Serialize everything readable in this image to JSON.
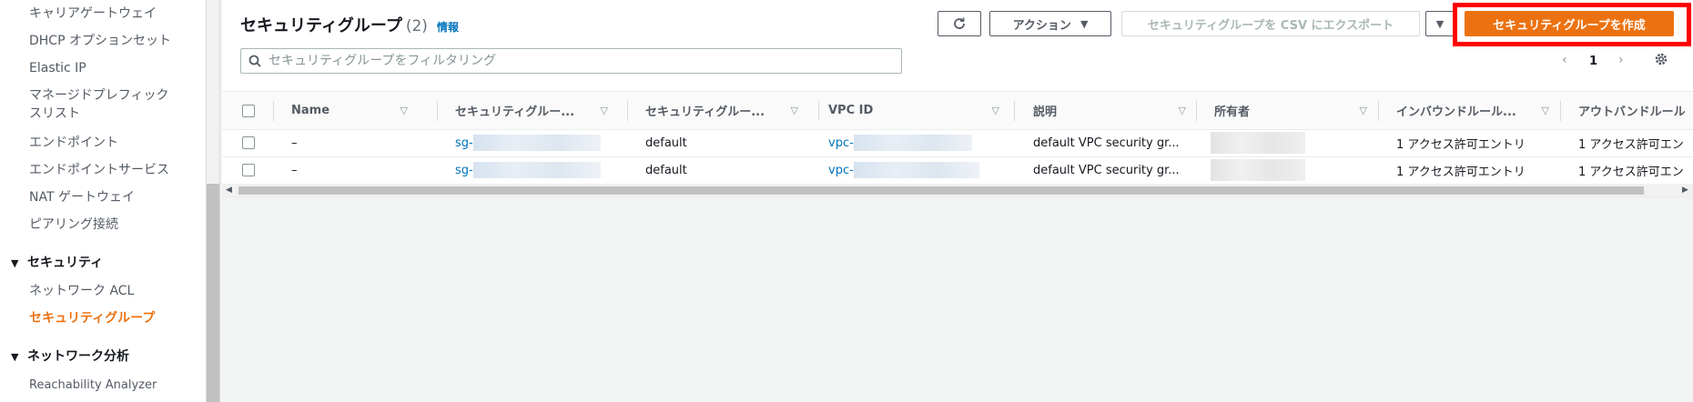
{
  "sidebar": {
    "items": [
      {
        "label": "キャリアゲートウェイ"
      },
      {
        "label": "DHCP オプションセット"
      },
      {
        "label": "Elastic IP"
      },
      {
        "label_line1": "マネージドプレフィック",
        "label_line2": "スリスト"
      },
      {
        "label": "エンドポイント"
      },
      {
        "label": "エンドポイントサービス"
      },
      {
        "label": "NAT ゲートウェイ"
      },
      {
        "label": "ピアリング接続"
      }
    ],
    "security_section": "セキュリティ",
    "security_items": [
      "ネットワーク ACL",
      "セキュリティグループ"
    ],
    "analysis_section": "ネットワーク分析",
    "analysis_items": [
      "Reachability Analyzer"
    ]
  },
  "header": {
    "title": "セキュリティグループ",
    "count": "(2)",
    "info": "情報",
    "actions_label": "アクション",
    "export_label": "セキュリティグループを CSV にエクスポート",
    "create_label": "セキュリティグループを作成"
  },
  "search": {
    "placeholder": "セキュリティグループをフィルタリング"
  },
  "pagination": {
    "page": "1"
  },
  "table": {
    "columns": [
      "Name",
      "セキュリティグルー...",
      "セキュリティグルー...",
      "VPC ID",
      "説明",
      "所有者",
      "インバウンドルール...",
      "アウトバンドルール"
    ],
    "rows": [
      {
        "name": "–",
        "sg_id": "sg-",
        "sg_name": "default",
        "vpc_id": "vpc-",
        "description": "default VPC security gr...",
        "inbound": "1 アクセス許可エントリ",
        "outbound": "1 アクセス許可エン"
      },
      {
        "name": "–",
        "sg_id": "sg-",
        "sg_name": "default",
        "vpc_id": "vpc-",
        "description": "default VPC security gr...",
        "inbound": "1 アクセス許可エントリ",
        "outbound": "1 アクセス許可エン"
      }
    ]
  },
  "colors": {
    "accent": "#ec7211",
    "link": "#0073bb",
    "highlight": "#ff0000"
  }
}
